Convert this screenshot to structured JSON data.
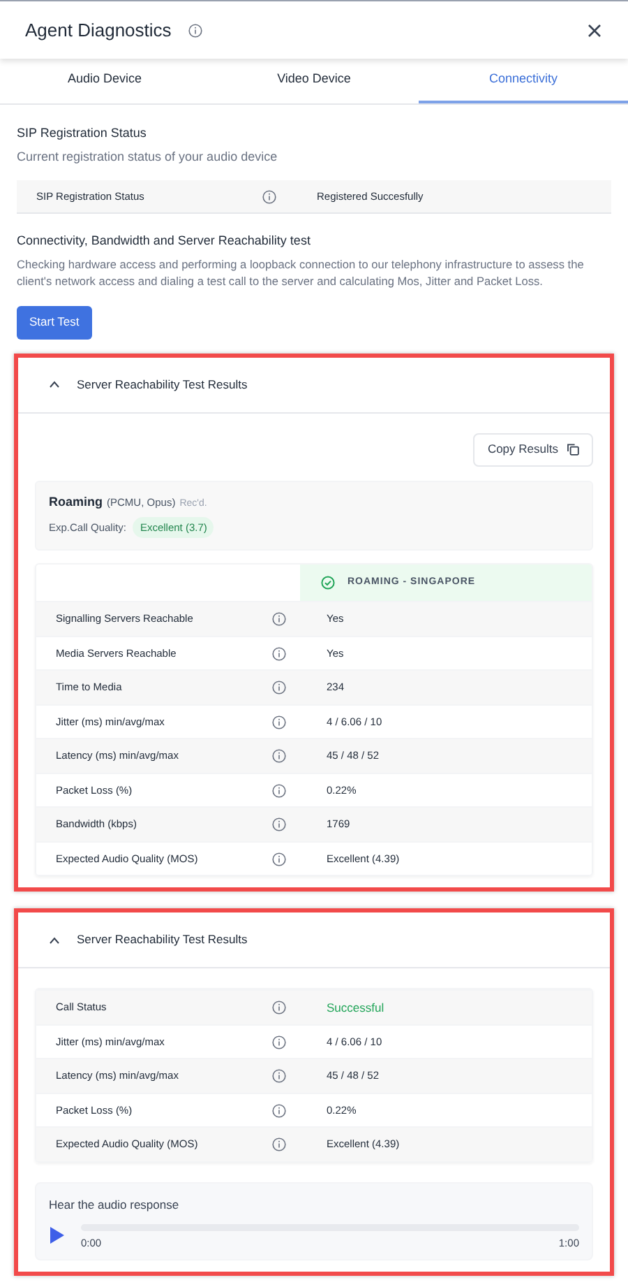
{
  "window": {
    "title": "Agent Diagnostics"
  },
  "tabs": [
    {
      "label": "Audio Device",
      "selected": false
    },
    {
      "label": "Video Device",
      "selected": false
    },
    {
      "label": "Connectivity",
      "selected": true
    }
  ],
  "sip": {
    "title": "SIP Registration Status",
    "subtitle": "Current registration status of your audio device",
    "row": {
      "label": "SIP Registration Status",
      "value": "Registered Succesfully"
    }
  },
  "connectivity": {
    "title": "Connectivity, Bandwidth and Server Reachability test",
    "description": "Checking hardware access and performing a loopback connection to our telephony infrastructure to assess the client's network access and dialing a test call to the server and calculating Mos, Jitter and Packet Loss.",
    "button": "Start Test"
  },
  "sections": [
    {
      "kind": "reachability",
      "title": "Server Reachability Test Results",
      "expanded": true,
      "highlighted": true,
      "copy_button": "Copy Results",
      "summary": {
        "name": "Roaming",
        "codecs": "(PCMU, Opus)",
        "note": "Rec'd.",
        "quality_label": "Exp.Call Quality:",
        "quality": "Excellent (3.7)"
      },
      "column_header": "ROAMING - SINGAPORE",
      "rows": [
        {
          "label": "Signalling Servers Reachable",
          "value": "Yes"
        },
        {
          "label": "Media Servers Reachable",
          "value": "Yes"
        },
        {
          "label": "Time to Media",
          "value": "234"
        },
        {
          "label": "Jitter (ms) min/avg/max",
          "value": "4 / 6.06 / 10"
        },
        {
          "label": "Latency (ms) min/avg/max",
          "value": "45 / 48 / 52"
        },
        {
          "label": "Packet Loss (%)",
          "value": "0.22%"
        },
        {
          "label": "Bandwidth (kbps)",
          "value": "1769"
        },
        {
          "label": "Expected Audio Quality (MOS)",
          "value": "Excellent (4.39)"
        }
      ]
    },
    {
      "kind": "call",
      "title": "Server Reachability Test Results",
      "expanded": true,
      "highlighted": true,
      "rows": [
        {
          "label": "Call Status",
          "value": "Successful",
          "color": "#22a559"
        },
        {
          "label": "Jitter (ms) min/avg/max",
          "value": "4 / 6.06 / 10"
        },
        {
          "label": "Latency (ms) min/avg/max",
          "value": "45 / 48 / 52"
        },
        {
          "label": "Packet Loss (%)",
          "value": "0.22%"
        },
        {
          "label": "Expected Audio Quality (MOS)",
          "value": "Excellent (4.39)"
        }
      ],
      "audio": {
        "title": "Hear the audio response",
        "level": 0,
        "current": "0:00",
        "duration": "1:00"
      }
    }
  ]
}
